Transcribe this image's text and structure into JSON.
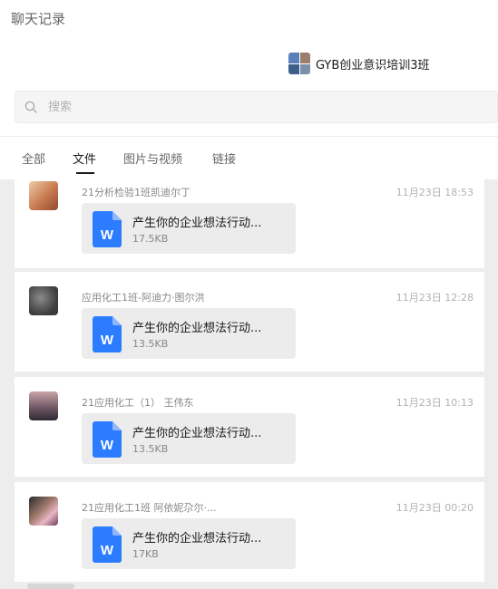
{
  "window": {
    "title": "聊天记录"
  },
  "chat": {
    "name": "GYB创业意识培训3班"
  },
  "search": {
    "placeholder": "搜索"
  },
  "tabs": [
    {
      "label": "全部",
      "active": false
    },
    {
      "label": "文件",
      "active": true
    },
    {
      "label": "图片与视频",
      "active": false
    },
    {
      "label": "链接",
      "active": false
    }
  ],
  "items": [
    {
      "sender": "21分析检验1班凯迪尔丁",
      "time": "11月23日 18:53",
      "file": {
        "name": "产生你的企业想法行动...",
        "size": "17.5KB"
      }
    },
    {
      "sender": "应用化工1班-阿迪力·图尔洪",
      "time": "11月23日 12:28",
      "file": {
        "name": "产生你的企业想法行动...",
        "size": "13.5KB"
      }
    },
    {
      "sender": "21应用化工（1） 王伟东",
      "time": "11月23日 10:13",
      "file": {
        "name": "产生你的企业想法行动...",
        "size": "13.5KB"
      }
    },
    {
      "sender": "21应用化工1班 阿依妮尕尔·...",
      "time": "11月23日 00:20",
      "file": {
        "name": "产生你的企业想法行动...",
        "size": "17KB"
      }
    }
  ],
  "icons": {
    "file_type": "word-doc-icon",
    "search": "search-icon"
  },
  "colors": {
    "word_blue": "#2b7cff",
    "active_tab": "#1a1a1a",
    "background": "#ededed"
  }
}
